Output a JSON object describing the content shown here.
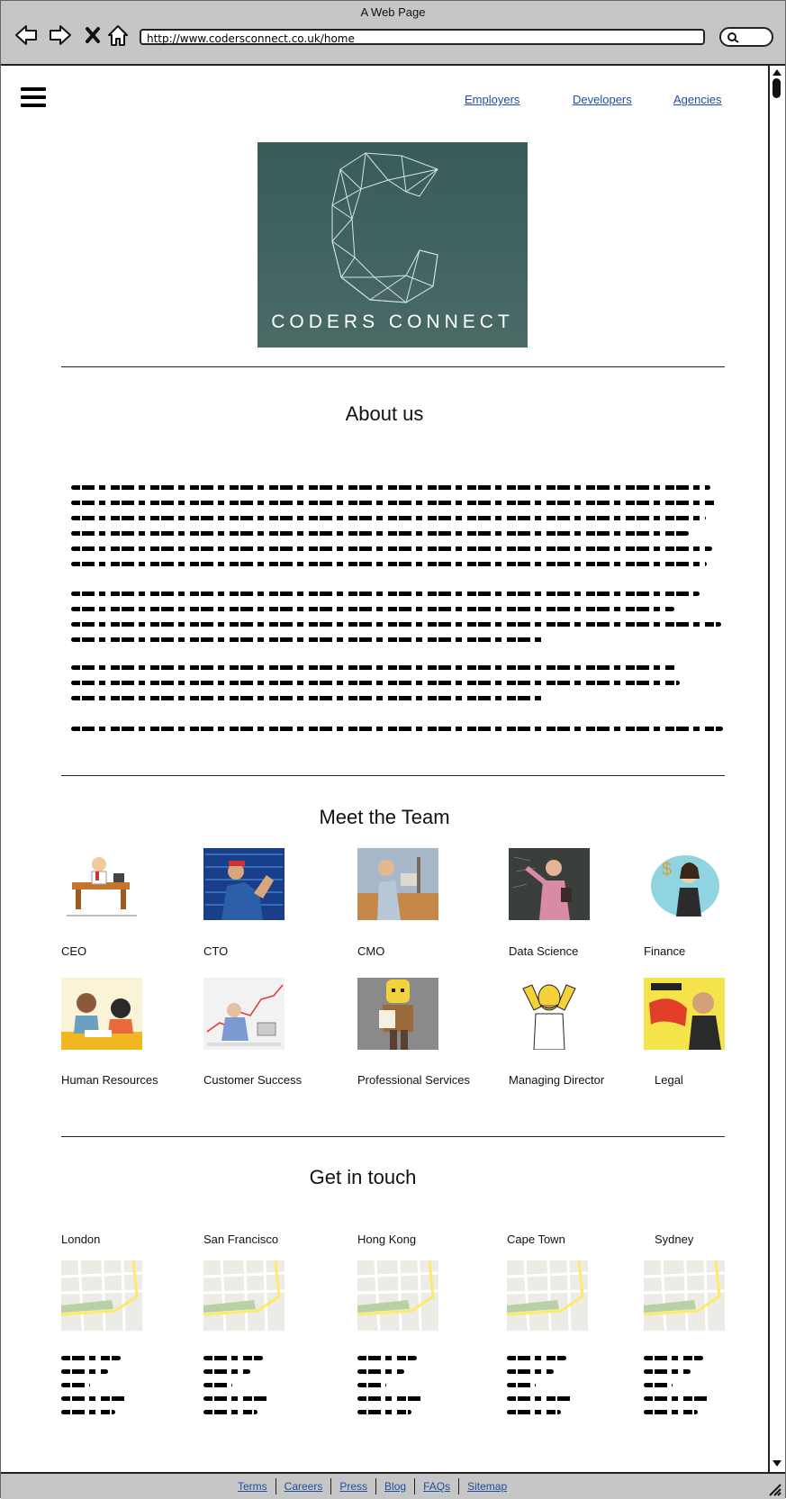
{
  "window": {
    "title": "A Web Page"
  },
  "browser": {
    "url": "http://www.codersconnect.co.uk/home"
  },
  "nav": {
    "links": [
      "Employers",
      "Developers",
      "Agencies"
    ]
  },
  "logo": {
    "text": "CODERS CONNECT"
  },
  "about": {
    "title": "About us"
  },
  "team": {
    "title": "Meet the Team",
    "members": [
      "CEO",
      "CTO",
      "CMO",
      "Data Science",
      "Finance",
      "Human Resources",
      "Customer Success",
      "Professional Services",
      "Managing Director",
      "Legal"
    ]
  },
  "contact": {
    "title": "Get in touch",
    "offices": [
      "London",
      "San Francisco",
      "Hong Kong",
      "Cape Town",
      "Sydney"
    ]
  },
  "footer": {
    "links": [
      "Terms",
      "Careers",
      "Press",
      "Blog",
      "FAQs",
      "Sitemap"
    ]
  },
  "colors": {
    "link": "#1f4e9e",
    "chrome": "#c6c6c6",
    "logo_bg": "#3f605d"
  },
  "icons": [
    "back-arrow-icon",
    "forward-arrow-icon",
    "close-icon",
    "home-icon",
    "search-icon",
    "hamburger-menu-icon",
    "resize-grip-icon"
  ]
}
